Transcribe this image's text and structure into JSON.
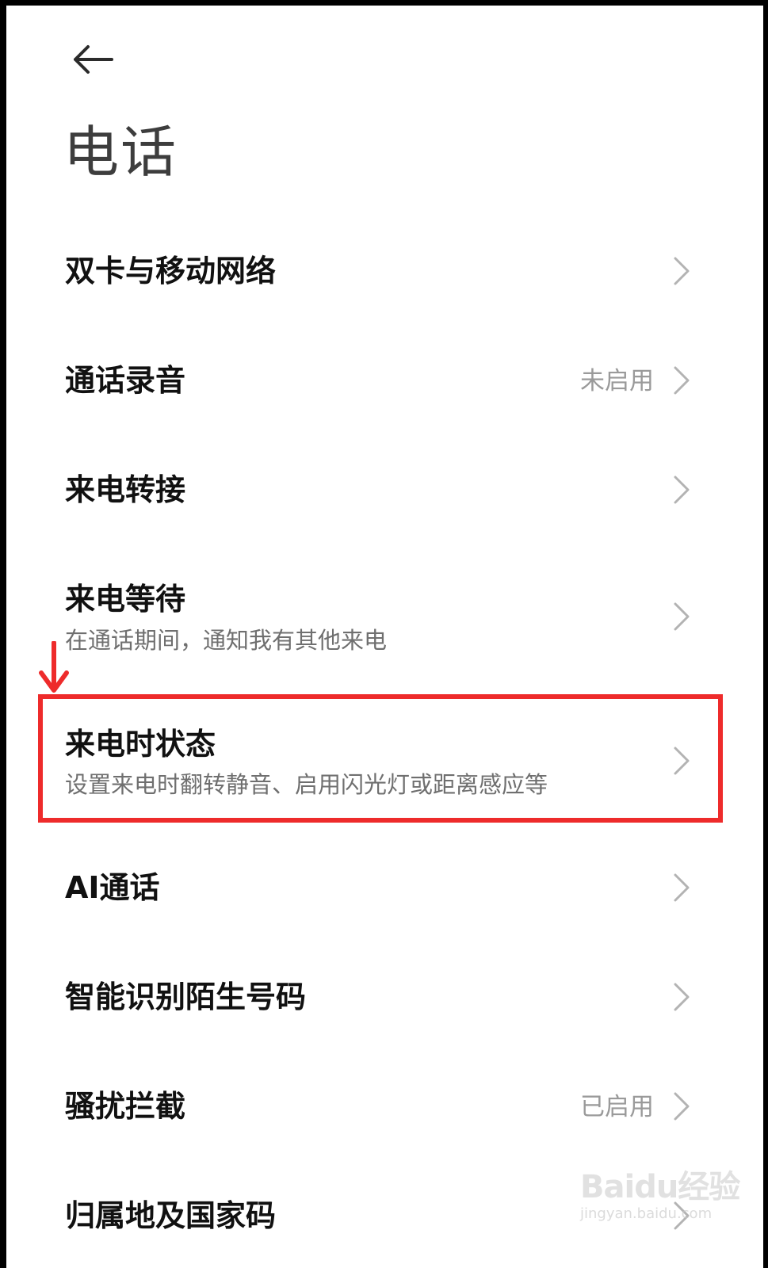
{
  "header": {
    "back_icon": "arrow-left-icon",
    "title": "电话"
  },
  "items": [
    {
      "title": "双卡与移动网络",
      "subtitle": "",
      "value": ""
    },
    {
      "title": "通话录音",
      "subtitle": "",
      "value": "未启用"
    },
    {
      "title": "来电转接",
      "subtitle": "",
      "value": ""
    },
    {
      "title": "来电等待",
      "subtitle": "在通话期间，通知我有其他来电",
      "value": ""
    },
    {
      "title": "来电时状态",
      "subtitle": "设置来电时翻转静音、启用闪光灯或距离感应等",
      "value": ""
    },
    {
      "title": "AI通话",
      "subtitle": "",
      "value": ""
    },
    {
      "title": "智能识别陌生号码",
      "subtitle": "",
      "value": ""
    },
    {
      "title": "骚扰拦截",
      "subtitle": "",
      "value": "已启用"
    },
    {
      "title": "归属地及国家码",
      "subtitle": "",
      "value": ""
    }
  ],
  "annotation": {
    "highlight_color": "#ee2b2b",
    "highlighted_item": "来电时状态"
  },
  "watermark": {
    "logo_text": "Baidu经验",
    "url_text": "jingyan.baidu.com"
  },
  "colors": {
    "title": "#111111",
    "subtitle": "#6f6f6f",
    "value": "#9a9a9a",
    "chevron": "#b3b3b3"
  }
}
